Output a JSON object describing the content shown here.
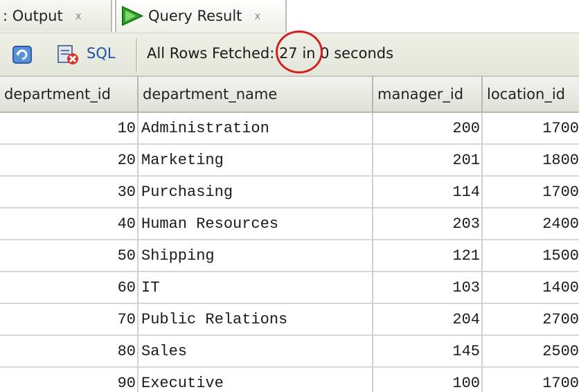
{
  "tabs": [
    {
      "label": ": Output",
      "close": "x",
      "active": false
    },
    {
      "label": "Query Result",
      "close": "x",
      "active": true
    }
  ],
  "toolbar": {
    "refresh_icon": "refresh-icon",
    "clear_icon": "clear-results-icon",
    "sql_label": "SQL",
    "status_text": "All Rows Fetched: 27 in 0 seconds"
  },
  "colors": {
    "highlight_circle": "#d4201c",
    "sql_link": "#1f4fa8",
    "play_green": "#2fa82a"
  },
  "table": {
    "columns": [
      "department_id",
      "department_name",
      "manager_id",
      "location_id"
    ],
    "rows": [
      [
        "10",
        "Administration",
        "200",
        "1700"
      ],
      [
        "20",
        "Marketing",
        "201",
        "1800"
      ],
      [
        "30",
        "Purchasing",
        "114",
        "1700"
      ],
      [
        "40",
        "Human Resources",
        "203",
        "2400"
      ],
      [
        "50",
        "Shipping",
        "121",
        "1500"
      ],
      [
        "60",
        "IT",
        "103",
        "1400"
      ],
      [
        "70",
        "Public Relations",
        "204",
        "2700"
      ],
      [
        "80",
        "Sales",
        "145",
        "2500"
      ],
      [
        "90",
        "Executive",
        "100",
        "1700"
      ]
    ]
  }
}
